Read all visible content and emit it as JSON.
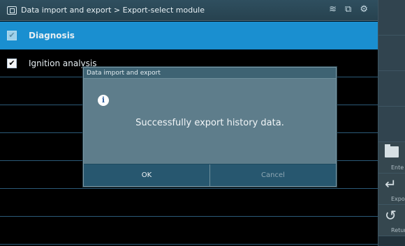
{
  "titlebar": {
    "breadcrumb": "Data import and export > Export-select module",
    "icons": [
      "home-icon",
      "wifi-icon",
      "connection-icon",
      "settings-icon"
    ]
  },
  "list": {
    "rows": [
      {
        "label": "Diagnosis",
        "checked": true,
        "selected": true
      },
      {
        "label": "Ignition analysis",
        "checked": true,
        "selected": false
      },
      {
        "label": "",
        "checked": false,
        "selected": false
      },
      {
        "label": "",
        "checked": false,
        "selected": false
      },
      {
        "label": "",
        "checked": false,
        "selected": false
      },
      {
        "label": "",
        "checked": false,
        "selected": false
      },
      {
        "label": "",
        "checked": false,
        "selected": false
      },
      {
        "label": "",
        "checked": false,
        "selected": false
      }
    ]
  },
  "sidebar": {
    "enter_label": "Ente",
    "export_label": "Expo",
    "return_label": "Retur"
  },
  "dialog": {
    "title": "Data import and export",
    "message": "Successfully export history data.",
    "ok_label": "OK",
    "cancel_label": "Cancel"
  },
  "colors": {
    "selected_row": "#1a8fd0",
    "dialog_body": "#5e7d8b",
    "dialog_buttons": "#27576f"
  }
}
